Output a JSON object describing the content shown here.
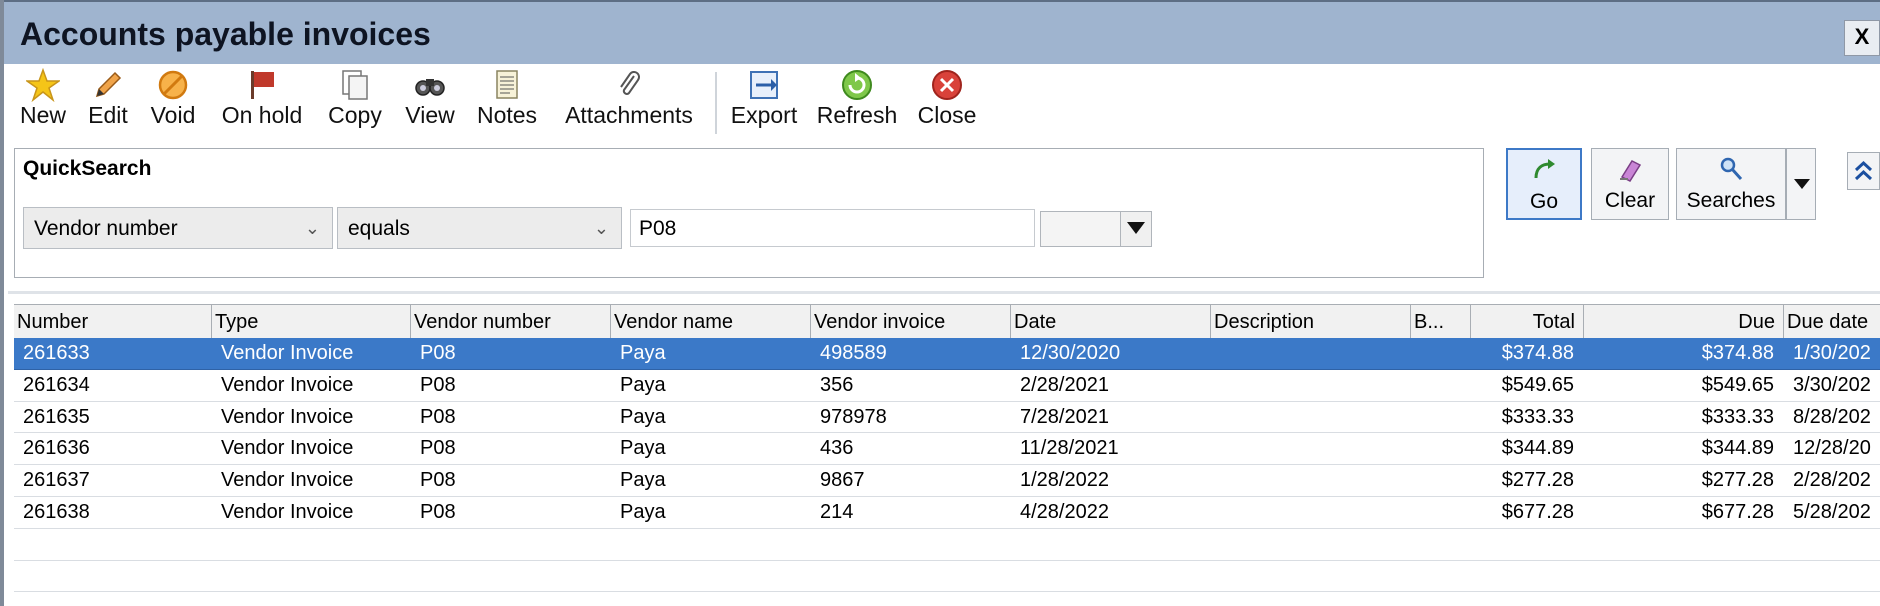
{
  "window": {
    "title": "Accounts payable invoices",
    "close_label": "X"
  },
  "toolbar": {
    "buttons": [
      {
        "label": "New",
        "icon": "star-icon"
      },
      {
        "label": "Edit",
        "icon": "pencil-icon"
      },
      {
        "label": "Void",
        "icon": "void-icon"
      },
      {
        "label": "On hold",
        "icon": "flag-icon"
      },
      {
        "label": "Copy",
        "icon": "copy-icon"
      },
      {
        "label": "View",
        "icon": "binoculars-icon"
      },
      {
        "label": "Notes",
        "icon": "notes-icon"
      },
      {
        "label": "Attachments",
        "icon": "paperclip-icon"
      },
      {
        "label": "Export",
        "icon": "export-icon"
      },
      {
        "label": "Refresh",
        "icon": "refresh-icon"
      },
      {
        "label": "Close",
        "icon": "close-circle-icon"
      }
    ]
  },
  "quicksearch": {
    "title": "QuickSearch",
    "field": "Vendor number",
    "operator": "equals",
    "value": "P08",
    "go_label": "Go",
    "clear_label": "Clear",
    "searches_label": "Searches"
  },
  "grid": {
    "columns": [
      "Number",
      "Type",
      "Vendor number",
      "Vendor name",
      "Vendor invoice",
      "Date",
      "Description",
      "B...",
      "Total",
      "Due",
      "Due date"
    ],
    "rows": [
      {
        "number": "261633",
        "type": "Vendor Invoice",
        "vendor_number": "P08",
        "vendor_name": "Paya",
        "vendor_invoice": "498589",
        "date": "12/30/2020",
        "description": "",
        "b": "",
        "total": "$374.88",
        "due": "$374.88",
        "due_date": "1/30/202",
        "selected": true
      },
      {
        "number": "261634",
        "type": "Vendor Invoice",
        "vendor_number": "P08",
        "vendor_name": "Paya",
        "vendor_invoice": "356",
        "date": "2/28/2021",
        "description": "",
        "b": "",
        "total": "$549.65",
        "due": "$549.65",
        "due_date": "3/30/202",
        "selected": false
      },
      {
        "number": "261635",
        "type": "Vendor Invoice",
        "vendor_number": "P08",
        "vendor_name": "Paya",
        "vendor_invoice": "978978",
        "date": "7/28/2021",
        "description": "",
        "b": "",
        "total": "$333.33",
        "due": "$333.33",
        "due_date": "8/28/202",
        "selected": false
      },
      {
        "number": "261636",
        "type": "Vendor Invoice",
        "vendor_number": "P08",
        "vendor_name": "Paya",
        "vendor_invoice": "436",
        "date": "11/28/2021",
        "description": "",
        "b": "",
        "total": "$344.89",
        "due": "$344.89",
        "due_date": "12/28/20",
        "selected": false
      },
      {
        "number": "261637",
        "type": "Vendor Invoice",
        "vendor_number": "P08",
        "vendor_name": "Paya",
        "vendor_invoice": "9867",
        "date": "1/28/2022",
        "description": "",
        "b": "",
        "total": "$277.28",
        "due": "$277.28",
        "due_date": "2/28/202",
        "selected": false
      },
      {
        "number": "261638",
        "type": "Vendor Invoice",
        "vendor_number": "P08",
        "vendor_name": "Paya",
        "vendor_invoice": "214",
        "date": "4/28/2022",
        "description": "",
        "b": "",
        "total": "$677.28",
        "due": "$677.28",
        "due_date": "5/28/202",
        "selected": false
      }
    ]
  },
  "colors": {
    "titlebar": "#9fb4cf",
    "selection": "#3b79c8"
  }
}
